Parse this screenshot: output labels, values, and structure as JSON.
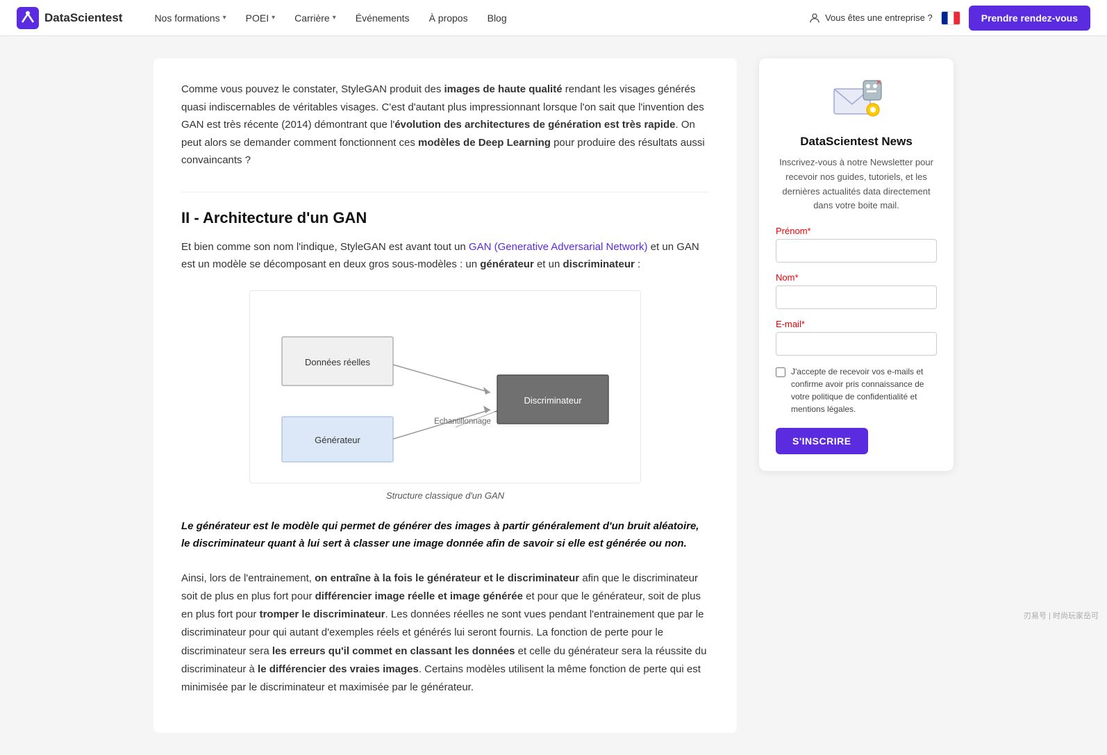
{
  "nav": {
    "logo_text": "DataScientest",
    "links": [
      {
        "label": "Nos formations",
        "has_chevron": true
      },
      {
        "label": "POEI",
        "has_chevron": true
      },
      {
        "label": "Carrière",
        "has_chevron": true
      },
      {
        "label": "Événements",
        "has_chevron": false
      },
      {
        "label": "À propos",
        "has_chevron": false
      },
      {
        "label": "Blog",
        "has_chevron": false
      }
    ],
    "enterprise_label": "Vous êtes une entreprise ?",
    "cta_label": "Prendre rendez-vous"
  },
  "main": {
    "intro": {
      "text_before_bold": "Comme vous pouvez le constater, StyleGAN produit des ",
      "bold1": "images de haute qualité",
      "text_mid1": " rendant les visages générés quasi indiscernables de véritables visages. C'est d'autant plus impressionnant lorsque l'on sait que l'invention des GAN est très récente (2014) démontrant que l'",
      "bold2": "évolution des architectures de génération est très rapide",
      "text_mid2": ". On peut alors se demander comment fonctionnent ces ",
      "bold3": "modèles de Deep Learning",
      "text_end": " pour produire des résultats aussi convaincants ?"
    },
    "section_title": "II - Architecture d'un GAN",
    "section_intro_before": "Et bien comme son nom l'indique, StyleGAN est avant tout un ",
    "section_link_text": "GAN (Generative Adversarial Network)",
    "section_intro_after": " et un GAN est un modèle se décomposant en deux gros sous-modèles : un ",
    "bold_generateur": "générateur",
    "section_mid": " et un ",
    "bold_discriminateur": "discriminateur",
    "section_end": " :",
    "diagram": {
      "caption": "Structure classique d'un GAN",
      "box1_label": "Données réelles",
      "box2_label": "Générateur",
      "box3_label": "Discriminateur",
      "arrow_label": "Echantillonnage"
    },
    "blockquote": "Le générateur est le modèle qui permet de générer des images à partir généralement d'un bruit aléatoire, le discriminateur quant à lui sert à classer une image donnée afin de savoir si elle est générée ou non.",
    "body1_before": "Ainsi, lors de l'entrainement, ",
    "body1_bold": "on entraîne à la fois le générateur et le discriminateur",
    "body1_mid1": " afin que le discriminateur soit de plus en plus fort pour ",
    "body1_bold2": "différencier image réelle et image générée",
    "body1_mid2": " et pour que le générateur, soit de plus en plus fort pour ",
    "body1_bold3": "tromper le discriminateur",
    "body1_mid3": ". Les données réelles ne sont vues pendant l'entrainement que par le discriminateur pour qui autant d'exemples réels et générés lui seront fournis. La fonction de perte pour le discriminateur sera ",
    "body1_bold4": "les erreurs qu'il commet en classant les données",
    "body1_mid4": " et celle du générateur sera la réussite du discriminateur à ",
    "body1_bold5": "le différencier des vraies images",
    "body1_end": ". Certains modèles utilisent la même fonction de perte qui est minimisée par le discriminateur et maximisée par le générateur."
  },
  "sidebar": {
    "newsletter_title": "DataScientest News",
    "newsletter_desc": "Inscrivez-vous à notre Newsletter pour recevoir nos guides, tutoriels, et les dernières actualités data directement dans votre boite mail.",
    "field_prenom_label": "Prénom",
    "field_nom_label": "Nom",
    "field_email_label": "E-mail",
    "checkbox_label": "J'accepte de recevoir vos e-mails et confirme avoir pris connaissance de votre politique de confidentialité et mentions légales.",
    "btn_inscrire": "S'INSCRIRE"
  },
  "watermark": "刃易号 | 时尚玩家岳可"
}
